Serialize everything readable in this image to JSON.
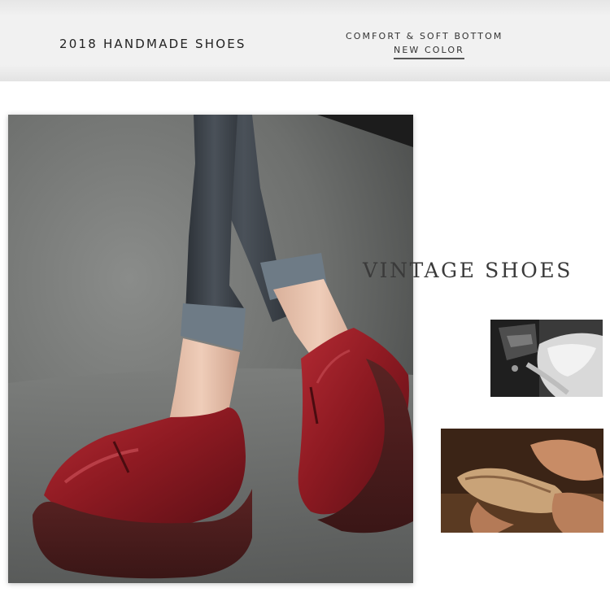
{
  "banner": {
    "title": "2018 HANDMADE SHOES",
    "tagline": "COMFORT & SOFT BOTTOM",
    "subtag": "NEW COLOR"
  },
  "section": {
    "heading": "VINTAGE SHOES"
  },
  "images": {
    "hero": "model-wearing-red-leather-platform-shoes",
    "craft_sewing": "black-and-white-shoe-sewing-machine",
    "craft_lasting": "hands-shaping-leather-on-shoe-last"
  },
  "colors": {
    "banner_bg": "#f1f1f1",
    "shoe_red": "#8e1a22",
    "sole_brown": "#4a1c1c",
    "heading_text": "#3a3a3a"
  }
}
